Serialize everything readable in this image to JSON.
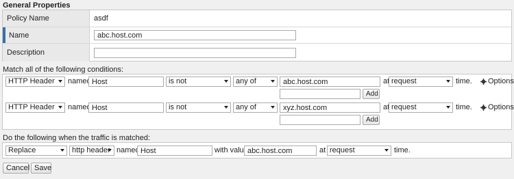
{
  "general": {
    "title": "General Properties",
    "policy_name_label": "Policy Name",
    "policy_name_value": "asdf",
    "name_label": "Name",
    "name_value": "abc.host.com",
    "description_label": "Description",
    "description_value": ""
  },
  "conditions": {
    "title": "Match all of the following conditions:",
    "rows": [
      {
        "type": "HTTP Header",
        "named_label": "named",
        "name": "Host",
        "operator": "is not",
        "quantifier": "any of",
        "value": "abc.host.com",
        "at_label": "at",
        "timing": "request",
        "time_label": "time.",
        "options_label": "Options",
        "add_value": "",
        "add_label": "Add"
      },
      {
        "type": "HTTP Header",
        "named_label": "named",
        "name": "Host",
        "operator": "is not",
        "quantifier": "any of",
        "value": "xyz.host.com",
        "at_label": "at",
        "timing": "request",
        "time_label": "time.",
        "options_label": "Options",
        "add_value": "",
        "add_label": "Add"
      }
    ]
  },
  "actions": {
    "title": "Do the following when the traffic is matched:",
    "row": {
      "action": "Replace",
      "target": "http header",
      "named_label": "named",
      "name": "Host",
      "with_label": "with value",
      "value": "abc.host.com",
      "at_label": "at",
      "timing": "request",
      "time_label": "time."
    }
  },
  "footer": {
    "cancel_label": "Cancel",
    "save_label": "Save"
  }
}
